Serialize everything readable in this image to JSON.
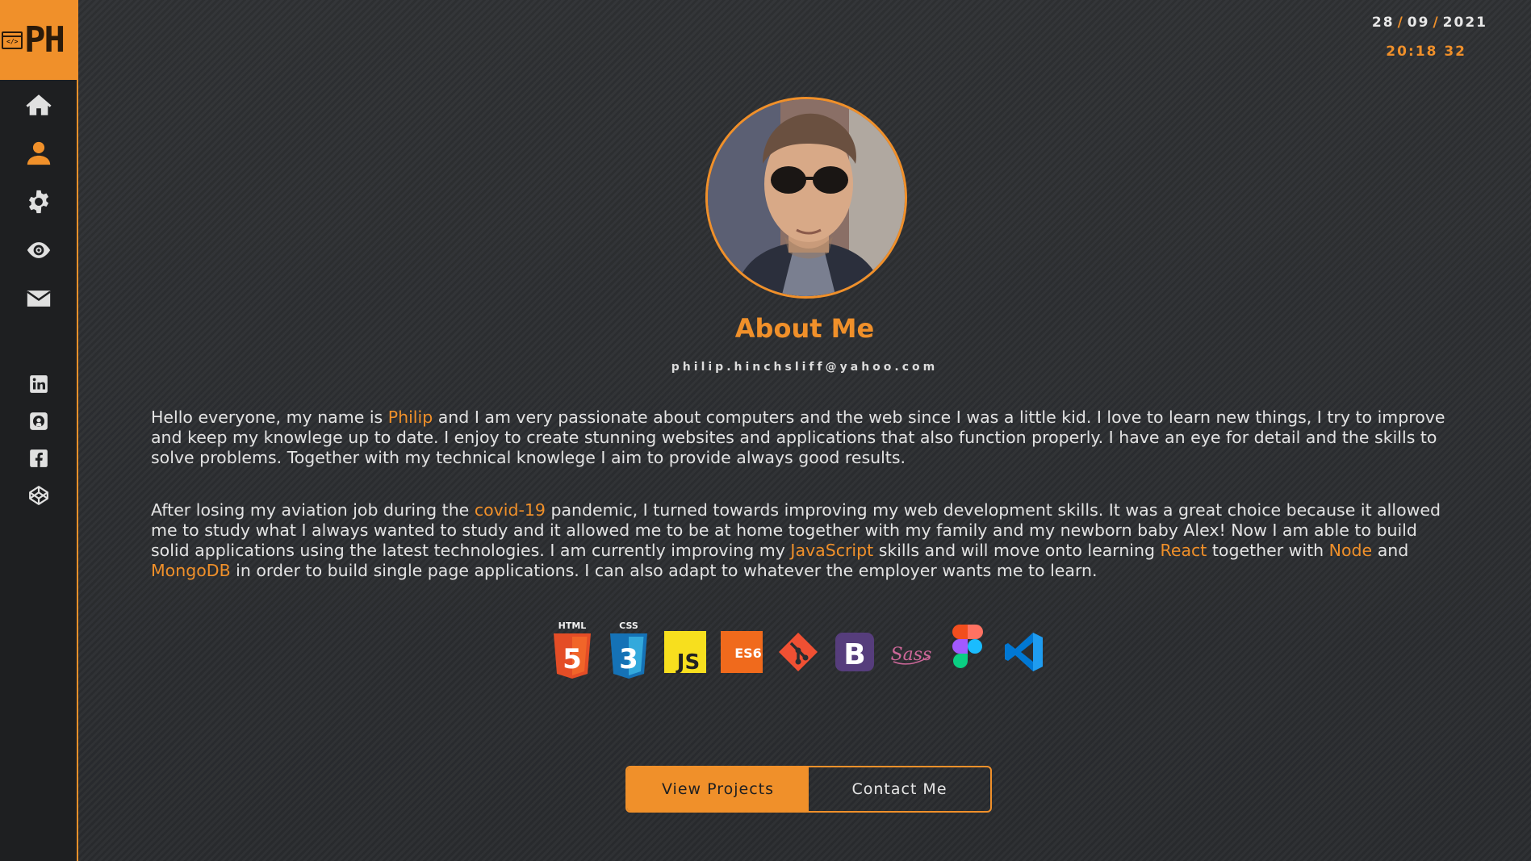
{
  "brand": {
    "logo_text": "PH",
    "logo_icon": "code-window-icon",
    "logo_icon_label": "</>"
  },
  "nav": [
    {
      "name": "home",
      "icon": "home-icon"
    },
    {
      "name": "about",
      "icon": "user-icon",
      "active": true
    },
    {
      "name": "skills",
      "icon": "gear-icon"
    },
    {
      "name": "projects",
      "icon": "eye-icon"
    },
    {
      "name": "contact",
      "icon": "mail-icon"
    }
  ],
  "social": [
    {
      "name": "linkedin",
      "icon": "linkedin-icon"
    },
    {
      "name": "github",
      "icon": "github-icon"
    },
    {
      "name": "facebook",
      "icon": "facebook-icon"
    },
    {
      "name": "codepen",
      "icon": "codepen-icon"
    }
  ],
  "datetime": {
    "day": "28",
    "month": "09",
    "year": "2021",
    "time": "20:18 32"
  },
  "about": {
    "title": "About Me",
    "email": "philip.hinchsliff@yahoo.com",
    "p1": {
      "a": "Hello everyone, my name is ",
      "name": "Philip",
      "b": " and I am very passionate about computers and the web since I was a little kid. I love to learn new things, I try to improve and keep my knowlege up to date. I enjoy to create stunning websites and applications that also function properly. I have an eye for detail and the skills to solve problems. Together with my technical knowlege I aim to provide always good results."
    },
    "p2": {
      "a": "After losing my aviation job during the ",
      "covid": "covid-19",
      "b": " pandemic, I turned towards improving my web development skills. It was a great choice because it allowed me to study what I always wanted to study and it allowed me to be at home together with my family and my newborn baby Alex! Now I am able to build solid applications using the latest technologies. I am currently improving my ",
      "js": "JavaScript",
      "c": " skills and will move onto learning ",
      "react": "React",
      "d": " together with ",
      "node": "Node",
      "e": " and ",
      "mongo": "MongoDB",
      "f": " in order to build single page applications. I can also adapt to whatever the employer wants me to learn."
    }
  },
  "tech": {
    "html_label": "HTML",
    "html_num": "5",
    "css_label": "CSS",
    "css_num": "3",
    "js_label": "JS",
    "es6_label": "ES6",
    "bootstrap_label": "B",
    "sass_label": "Sass"
  },
  "colors": {
    "accent": "#f0902a",
    "sidebar": "#1e1f21",
    "background": "#2b2d30"
  },
  "buttons": {
    "projects": "View Projects",
    "contact": "Contact Me"
  }
}
